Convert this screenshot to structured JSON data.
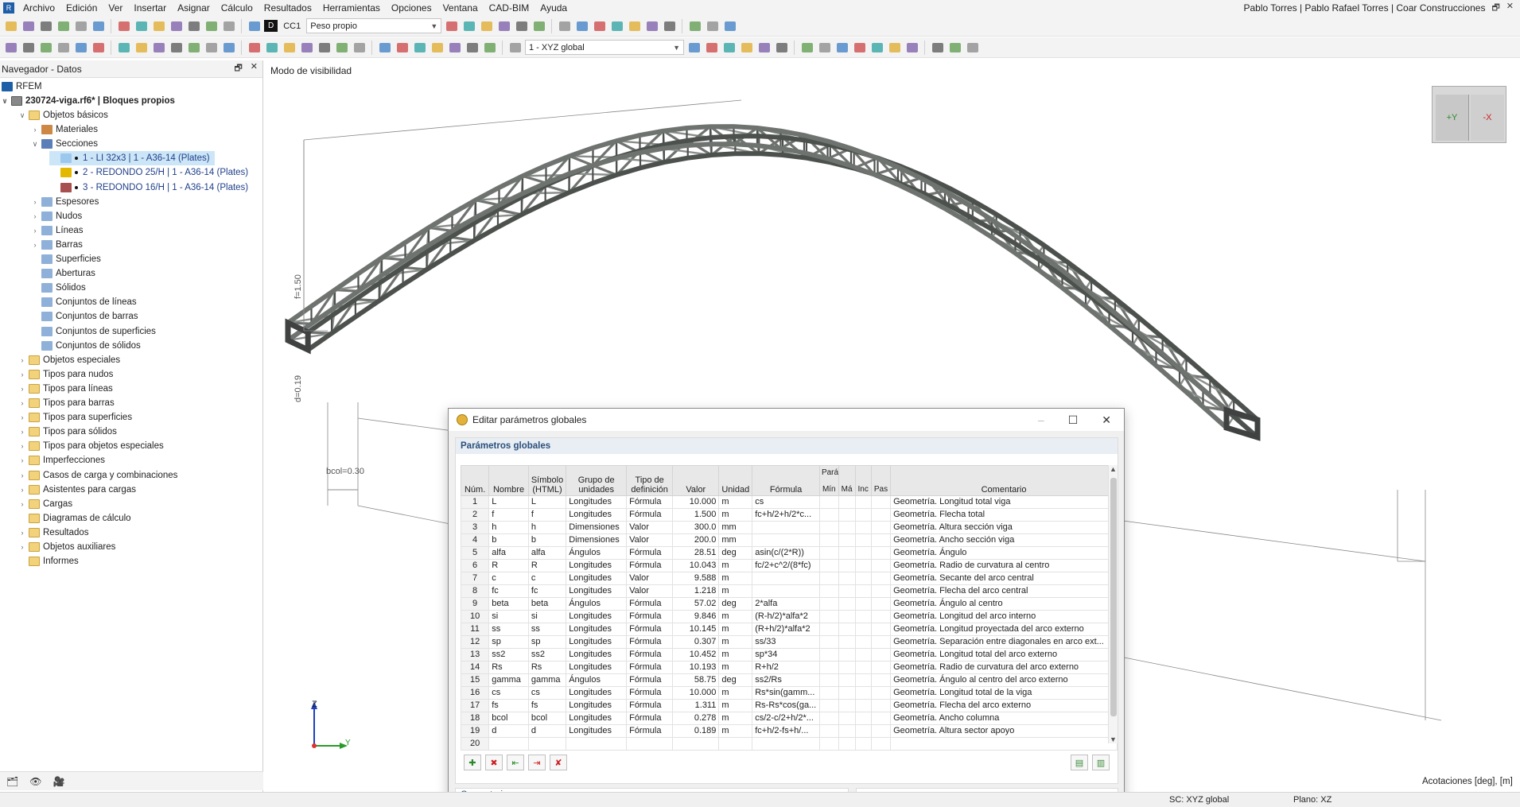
{
  "menu": {
    "items": [
      "Archivo",
      "Edición",
      "Ver",
      "Insertar",
      "Asignar",
      "Cálculo",
      "Resultados",
      "Herramientas",
      "Opciones",
      "Ventana",
      "CAD-BIM",
      "Ayuda"
    ],
    "user": "Pablo Torres | Pablo Rafael Torres | Coar Construcciones"
  },
  "toolbar": {
    "loadcase_tag": "D",
    "loadcase_id": "CC1",
    "loadcase_name": "Peso propio",
    "coord_system": "1 - XYZ global"
  },
  "navigator": {
    "title": "Navegador - Datos",
    "root": "RFEM",
    "file": "230724-viga.rf6* | Bloques propios",
    "items": [
      {
        "label": "Objetos básicos",
        "level": 1,
        "exp": "v",
        "icon": "folder"
      },
      {
        "label": "Materiales",
        "level": 2,
        "exp": ">",
        "icon": "materials"
      },
      {
        "label": "Secciones",
        "level": 2,
        "exp": "v",
        "icon": "sections"
      },
      {
        "label": "1 - LI 32x3 | 1 - A36-14 (Plates)",
        "level": 3,
        "exp": "",
        "icon": "sec1",
        "selected": true
      },
      {
        "label": "2 - REDONDO 25/H | 1 - A36-14 (Plates)",
        "level": 3,
        "exp": "",
        "icon": "sec2"
      },
      {
        "label": "3 - REDONDO 16/H | 1 - A36-14 (Plates)",
        "level": 3,
        "exp": "",
        "icon": "sec3"
      },
      {
        "label": "Espesores",
        "level": 2,
        "exp": ">",
        "icon": "obj"
      },
      {
        "label": "Nudos",
        "level": 2,
        "exp": ">",
        "icon": "obj"
      },
      {
        "label": "Líneas",
        "level": 2,
        "exp": ">",
        "icon": "obj"
      },
      {
        "label": "Barras",
        "level": 2,
        "exp": ">",
        "icon": "obj"
      },
      {
        "label": "Superficies",
        "level": 2,
        "exp": "",
        "icon": "obj"
      },
      {
        "label": "Aberturas",
        "level": 2,
        "exp": "",
        "icon": "obj"
      },
      {
        "label": "Sólidos",
        "level": 2,
        "exp": "",
        "icon": "obj"
      },
      {
        "label": "Conjuntos de líneas",
        "level": 2,
        "exp": "",
        "icon": "obj"
      },
      {
        "label": "Conjuntos de barras",
        "level": 2,
        "exp": "",
        "icon": "obj"
      },
      {
        "label": "Conjuntos de superficies",
        "level": 2,
        "exp": "",
        "icon": "obj"
      },
      {
        "label": "Conjuntos de sólidos",
        "level": 2,
        "exp": "",
        "icon": "obj"
      },
      {
        "label": "Objetos especiales",
        "level": 1,
        "exp": ">",
        "icon": "folder"
      },
      {
        "label": "Tipos para nudos",
        "level": 1,
        "exp": ">",
        "icon": "folder"
      },
      {
        "label": "Tipos para líneas",
        "level": 1,
        "exp": ">",
        "icon": "folder"
      },
      {
        "label": "Tipos para barras",
        "level": 1,
        "exp": ">",
        "icon": "folder"
      },
      {
        "label": "Tipos para superficies",
        "level": 1,
        "exp": ">",
        "icon": "folder"
      },
      {
        "label": "Tipos para sólidos",
        "level": 1,
        "exp": ">",
        "icon": "folder"
      },
      {
        "label": "Tipos para objetos especiales",
        "level": 1,
        "exp": ">",
        "icon": "folder"
      },
      {
        "label": "Imperfecciones",
        "level": 1,
        "exp": ">",
        "icon": "folder"
      },
      {
        "label": "Casos de carga y combinaciones",
        "level": 1,
        "exp": ">",
        "icon": "folder"
      },
      {
        "label": "Asistentes para cargas",
        "level": 1,
        "exp": ">",
        "icon": "folder"
      },
      {
        "label": "Cargas",
        "level": 1,
        "exp": ">",
        "icon": "folder"
      },
      {
        "label": "Diagramas de cálculo",
        "level": 1,
        "exp": "",
        "icon": "folder"
      },
      {
        "label": "Resultados",
        "level": 1,
        "exp": ">",
        "icon": "folder"
      },
      {
        "label": "Objetos auxiliares",
        "level": 1,
        "exp": ">",
        "icon": "folder"
      },
      {
        "label": "Informes",
        "level": 1,
        "exp": "",
        "icon": "folder"
      }
    ]
  },
  "viewport": {
    "title": "Modo de visibilidad",
    "dims": {
      "f": "f=1.50",
      "d": "d=0.19",
      "bcol": "bcol=0.30"
    },
    "axes": {
      "z": "Z",
      "y": "Y"
    },
    "cube": {
      "y": "+Y",
      "x": "-X"
    }
  },
  "dialog": {
    "title": "Editar parámetros globales",
    "section": "Parámetros globales",
    "comment_label": "Comentario",
    "headers": {
      "num": "Núm.",
      "name": "Nombre",
      "symbol": "Símbolo (HTML)",
      "group": "Grupo de unidades",
      "def": "Tipo de definición",
      "value": "Valor",
      "unit": "Unidad",
      "formula": "Fórmula",
      "params": "Parámetros de",
      "min": "Mín",
      "max": "Má",
      "inc": "Inc",
      "pas": "Pas",
      "comment": "Comentario"
    },
    "rows": [
      [
        "1",
        "L",
        "L",
        "Longitudes",
        "Fórmula",
        "10.000",
        "m",
        "cs",
        "Geometría. Longitud total viga"
      ],
      [
        "2",
        "f",
        "f",
        "Longitudes",
        "Fórmula",
        "1.500",
        "m",
        "fc+h/2+h/2*c...",
        "Geometría. Flecha total"
      ],
      [
        "3",
        "h",
        "h",
        "Dimensiones",
        "Valor",
        "300.0",
        "mm",
        "",
        "Geometría. Altura sección viga"
      ],
      [
        "4",
        "b",
        "b",
        "Dimensiones",
        "Valor",
        "200.0",
        "mm",
        "",
        "Geometría. Ancho sección viga"
      ],
      [
        "5",
        "alfa",
        "alfa",
        "Ángulos",
        "Fórmula",
        "28.51",
        "deg",
        "asin(c/(2*R))",
        "Geometría. Ángulo"
      ],
      [
        "6",
        "R",
        "R",
        "Longitudes",
        "Fórmula",
        "10.043",
        "m",
        "fc/2+c^2/(8*fc)",
        "Geometría. Radio de curvatura al centro"
      ],
      [
        "7",
        "c",
        "c",
        "Longitudes",
        "Valor",
        "9.588",
        "m",
        "",
        "Geometría. Secante del arco central"
      ],
      [
        "8",
        "fc",
        "fc",
        "Longitudes",
        "Valor",
        "1.218",
        "m",
        "",
        "Geometría. Flecha del arco central"
      ],
      [
        "9",
        "beta",
        "beta",
        "Ángulos",
        "Fórmula",
        "57.02",
        "deg",
        "2*alfa",
        "Geometría. Ángulo al centro"
      ],
      [
        "10",
        "si",
        "si",
        "Longitudes",
        "Fórmula",
        "9.846",
        "m",
        "(R-h/2)*alfa*2",
        "Geometría. Longitud del arco interno"
      ],
      [
        "11",
        "ss",
        "ss",
        "Longitudes",
        "Fórmula",
        "10.145",
        "m",
        "(R+h/2)*alfa*2",
        "Geometría. Longitud proyectada del arco externo"
      ],
      [
        "12",
        "sp",
        "sp",
        "Longitudes",
        "Fórmula",
        "0.307",
        "m",
        "ss/33",
        "Geometría. Separación entre diagonales en arco ext..."
      ],
      [
        "13",
        "ss2",
        "ss2",
        "Longitudes",
        "Fórmula",
        "10.452",
        "m",
        "sp*34",
        "Geometría. Longitud total del arco externo"
      ],
      [
        "14",
        "Rs",
        "Rs",
        "Longitudes",
        "Fórmula",
        "10.193",
        "m",
        "R+h/2",
        "Geometría. Radio de curvatura del arco externo"
      ],
      [
        "15",
        "gamma",
        "gamma",
        "Ángulos",
        "Fórmula",
        "58.75",
        "deg",
        "ss2/Rs",
        "Geometría. Ángulo al centro del arco externo"
      ],
      [
        "16",
        "cs",
        "cs",
        "Longitudes",
        "Fórmula",
        "10.000",
        "m",
        "Rs*sin(gamm...",
        "Geometría. Longitud total de la viga"
      ],
      [
        "17",
        "fs",
        "fs",
        "Longitudes",
        "Fórmula",
        "1.311",
        "m",
        "Rs-Rs*cos(ga...",
        "Geometría. Flecha del arco externo"
      ],
      [
        "18",
        "bcol",
        "bcol",
        "Longitudes",
        "Fórmula",
        "0.278",
        "m",
        "cs/2-c/2+h/2*...",
        "Geometría. Ancho columna"
      ],
      [
        "19",
        "d",
        "d",
        "Longitudes",
        "Fórmula",
        "0.189",
        "m",
        "fc+h/2-fs+h/...",
        "Geometría. Altura sector apoyo"
      ],
      [
        "20",
        "",
        "",
        "",
        "",
        "",
        "",
        "",
        ""
      ]
    ]
  },
  "status": {
    "annot": "Acotaciones [deg], [m]",
    "sc": "SC: XYZ global",
    "plane": "Plano: XZ"
  },
  "colors": {
    "steel": "#6f7370",
    "steel_dark": "#4d514e",
    "accent": "#1f5fa8"
  }
}
